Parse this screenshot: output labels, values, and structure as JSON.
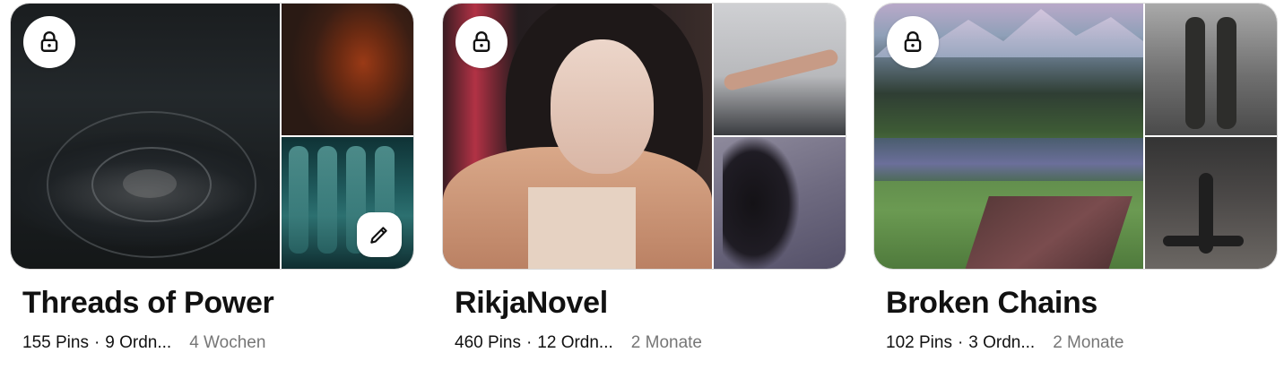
{
  "boards": [
    {
      "title": "Threads of Power",
      "pins": "155 Pins",
      "sections": "9 Ordn...",
      "separator": "·",
      "updated": "4 Wochen",
      "secret": true,
      "editable": true,
      "lock_icon": "lock-icon",
      "edit_icon": "pencil-icon"
    },
    {
      "title": "RikjaNovel",
      "pins": "460 Pins",
      "sections": "12 Ordn...",
      "separator": "·",
      "updated": "2 Monate",
      "secret": true,
      "lock_icon": "lock-icon"
    },
    {
      "title": "Broken Chains",
      "pins": "102 Pins",
      "sections": "3 Ordn...",
      "separator": "·",
      "updated": "2 Monate",
      "secret": true,
      "lock_icon": "lock-icon"
    }
  ],
  "colors": {
    "title_text": "#111111",
    "muted_text": "#767676",
    "badge_bg": "#ffffff"
  }
}
